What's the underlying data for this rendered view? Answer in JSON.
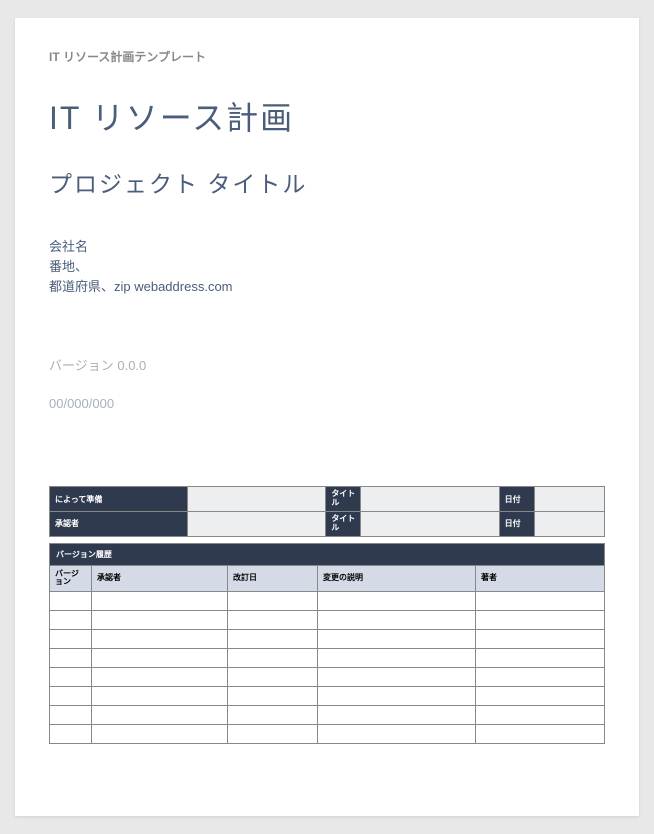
{
  "template_label": "IT リソース計画テンプレート",
  "main_title": "IT リソース計画",
  "project_title": "プロジェクト タイトル",
  "company": {
    "name": "会社名",
    "street": "番地、",
    "region": "都道府県、zip webaddress.com"
  },
  "version_text": "バージョン 0.0.0",
  "date_text": "00/000/000",
  "approval": {
    "prepared_label": "によって準備",
    "title_label": "タイトル",
    "date_label": "日付",
    "approver_label": "承認者",
    "prepared_value": "",
    "prepared_title": "",
    "prepared_date": "",
    "approver_value": "",
    "approver_title": "",
    "approver_date": ""
  },
  "history": {
    "header": "バージョン履歴",
    "columns": {
      "version": "バージョン",
      "approver": "承認者",
      "revdate": "改訂日",
      "change": "変更の説明",
      "author": "著者"
    },
    "rows": [
      {
        "version": "",
        "approver": "",
        "revdate": "",
        "change": "",
        "author": ""
      },
      {
        "version": "",
        "approver": "",
        "revdate": "",
        "change": "",
        "author": ""
      },
      {
        "version": "",
        "approver": "",
        "revdate": "",
        "change": "",
        "author": ""
      },
      {
        "version": "",
        "approver": "",
        "revdate": "",
        "change": "",
        "author": ""
      },
      {
        "version": "",
        "approver": "",
        "revdate": "",
        "change": "",
        "author": ""
      },
      {
        "version": "",
        "approver": "",
        "revdate": "",
        "change": "",
        "author": ""
      },
      {
        "version": "",
        "approver": "",
        "revdate": "",
        "change": "",
        "author": ""
      },
      {
        "version": "",
        "approver": "",
        "revdate": "",
        "change": "",
        "author": ""
      }
    ]
  }
}
